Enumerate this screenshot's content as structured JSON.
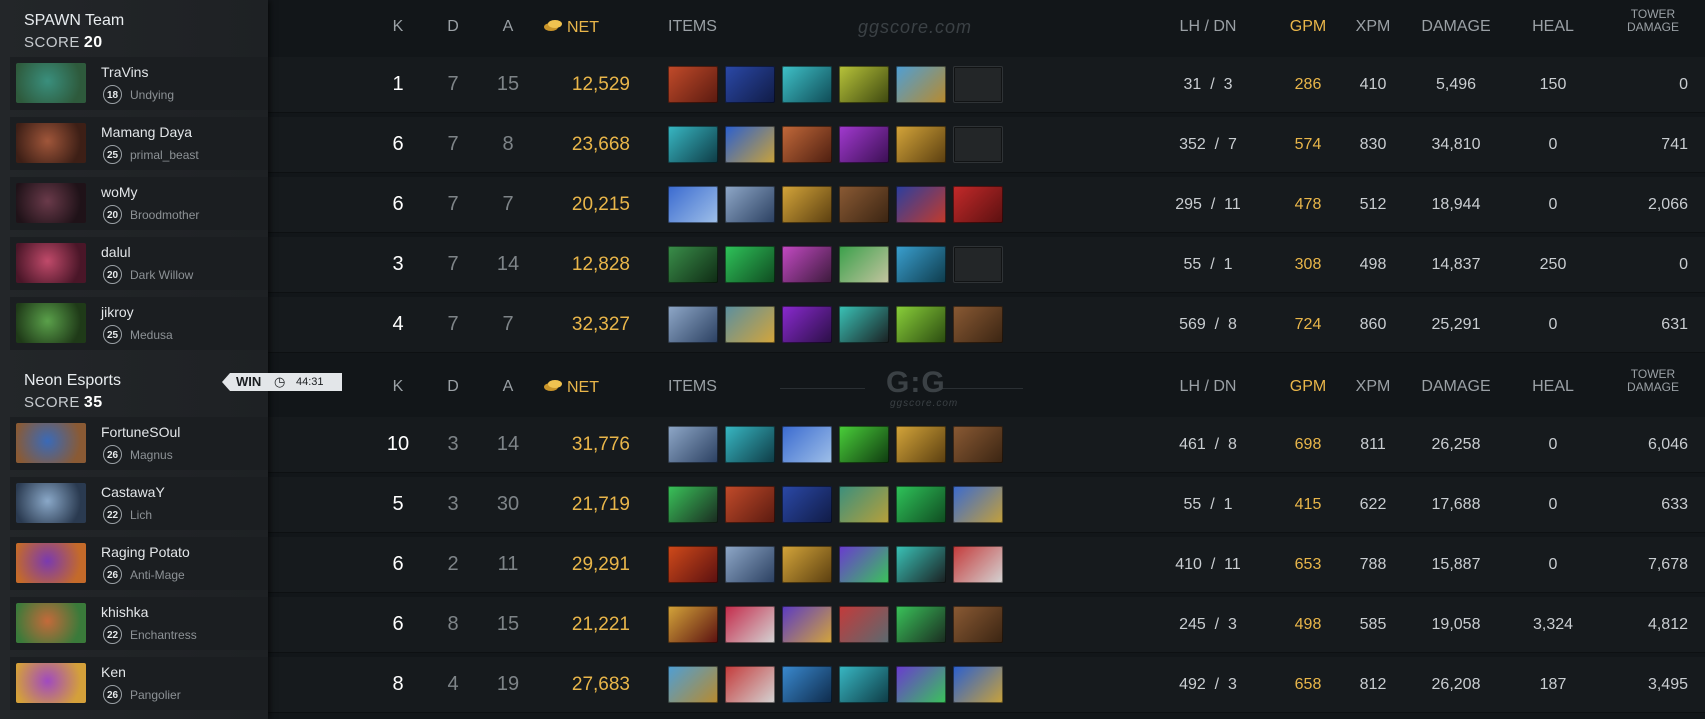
{
  "headers": {
    "k": "K",
    "d": "D",
    "a": "A",
    "net": "NET",
    "items": "ITEMS",
    "lh_dn": "LH  /  DN",
    "gpm": "GPM",
    "xpm": "XPM",
    "damage": "DAMAGE",
    "heal": "HEAL",
    "tower1": "TOWER",
    "tower2": "DAMAGE"
  },
  "watermark1": "ggscore.com",
  "watermark2_big": "G:G",
  "watermark2_small": "ggscore.com",
  "colors": {
    "gold": "#e9b64a",
    "bg": "#121619",
    "sidebar": "#232629"
  },
  "result": {
    "label": "WIN",
    "clock_icon": "clock-icon",
    "time": "44:31"
  },
  "teams": [
    {
      "name": "SPAWN Team",
      "score_label": "SCORE",
      "score": "20",
      "players": [
        {
          "name": "TraVins",
          "level": "18",
          "hero": "Undying",
          "k": "1",
          "d": "7",
          "a": "15",
          "net": "12,529",
          "lh": "31",
          "dn": "3",
          "gpm": "286",
          "xpm": "410",
          "damage": "5,496",
          "heal": "150",
          "tower": "0",
          "colors": [
            "#3a8f7d",
            "#2e5a3c"
          ],
          "items": [
            [
              "#c24b2a",
              "#5a1a10"
            ],
            [
              "#2b49a8",
              "#101b45"
            ],
            [
              "#3fc2c9",
              "#0f4a55"
            ],
            [
              "#b8c43a",
              "#3d4710"
            ],
            [
              "#4e9fd6",
              "#b98a2c"
            ],
            null
          ]
        },
        {
          "name": "Mamang Daya",
          "level": "25",
          "hero": "primal_beast",
          "k": "6",
          "d": "7",
          "a": "8",
          "net": "23,668",
          "lh": "352",
          "dn": "7",
          "gpm": "574",
          "xpm": "830",
          "damage": "34,810",
          "heal": "0",
          "tower": "741",
          "colors": [
            "#a0563a",
            "#3d1f16"
          ],
          "items": [
            [
              "#38b8c4",
              "#0e3a44"
            ],
            [
              "#2a5fd0",
              "#c9a23a"
            ],
            [
              "#c2693a",
              "#4d1e10"
            ],
            [
              "#a23ad0",
              "#3a0f52"
            ],
            [
              "#d4a53a",
              "#5a3e10"
            ],
            null
          ]
        },
        {
          "name": "woMy",
          "level": "20",
          "hero": "Broodmother",
          "k": "6",
          "d": "7",
          "a": "7",
          "net": "20,215",
          "lh": "295",
          "dn": "11",
          "gpm": "478",
          "xpm": "512",
          "damage": "18,944",
          "heal": "0",
          "tower": "2,066",
          "colors": [
            "#6a3a4a",
            "#1f1218"
          ],
          "items": [
            [
              "#3a6ad0",
              "#9fc0e8"
            ],
            [
              "#8fa8c8",
              "#2a3f60"
            ],
            [
              "#d4a53a",
              "#5a3e10"
            ],
            [
              "#8a5a34",
              "#3a2412"
            ],
            [
              "#2a3fa0",
              "#c43a2a"
            ],
            [
              "#c42a2a",
              "#5a1010"
            ]
          ]
        },
        {
          "name": "dalul",
          "level": "20",
          "hero": "Dark Willow",
          "k": "3",
          "d": "7",
          "a": "14",
          "net": "12,828",
          "lh": "55",
          "dn": "1",
          "gpm": "308",
          "xpm": "498",
          "damage": "14,837",
          "heal": "250",
          "tower": "0",
          "colors": [
            "#c04a6a",
            "#4a1628"
          ],
          "items": [
            [
              "#3a8f4a",
              "#0f2a14"
            ],
            [
              "#2fc45a",
              "#0f4a20"
            ],
            [
              "#c44ac4",
              "#3a1a3a"
            ],
            [
              "#3aa04a",
              "#c4c4a0"
            ],
            [
              "#3aa0d0",
              "#0e3a4a"
            ],
            null
          ]
        },
        {
          "name": "jikroy",
          "level": "25",
          "hero": "Medusa",
          "k": "4",
          "d": "7",
          "a": "7",
          "net": "32,327",
          "lh": "569",
          "dn": "8",
          "gpm": "724",
          "xpm": "860",
          "damage": "25,291",
          "heal": "0",
          "tower": "631",
          "colors": [
            "#5aa04a",
            "#1f3a18"
          ],
          "items": [
            [
              "#8fa8c8",
              "#2a3f60"
            ],
            [
              "#5a8fa0",
              "#d4a53a"
            ],
            [
              "#8a2ad0",
              "#2a0f45"
            ],
            [
              "#3ac4b8",
              "#1a1e20"
            ],
            [
              "#8ad03a",
              "#2a4a10"
            ],
            [
              "#8a5a34",
              "#3a2412"
            ]
          ]
        }
      ]
    },
    {
      "name": "Neon Esports",
      "score_label": "SCORE",
      "score": "35",
      "players": [
        {
          "name": "FortuneSOul",
          "level": "26",
          "hero": "Magnus",
          "k": "10",
          "d": "3",
          "a": "14",
          "net": "31,776",
          "lh": "461",
          "dn": "8",
          "gpm": "698",
          "xpm": "811",
          "damage": "26,258",
          "heal": "0",
          "tower": "6,046",
          "colors": [
            "#3a6ab8",
            "#8a5a34"
          ],
          "items": [
            [
              "#8fa8c8",
              "#2a3f60"
            ],
            [
              "#38b8c4",
              "#0e3a44"
            ],
            [
              "#3a6ad0",
              "#9fc0e8"
            ],
            [
              "#4ad03a",
              "#0f3a10"
            ],
            [
              "#d4a53a",
              "#5a3e10"
            ],
            [
              "#8a5a34",
              "#3a2412"
            ]
          ]
        },
        {
          "name": "CastawaY",
          "level": "22",
          "hero": "Lich",
          "k": "5",
          "d": "3",
          "a": "30",
          "net": "21,719",
          "lh": "55",
          "dn": "1",
          "gpm": "415",
          "xpm": "622",
          "damage": "17,688",
          "heal": "0",
          "tower": "633",
          "colors": [
            "#8aa8c8",
            "#2a3a50"
          ],
          "items": [
            [
              "#3ac45a",
              "#1a2a20"
            ],
            [
              "#c24b2a",
              "#5a1a10"
            ],
            [
              "#2b49a8",
              "#101b45"
            ],
            [
              "#3a8f7d",
              "#b8a03a"
            ],
            [
              "#2fc45a",
              "#0f4a20"
            ],
            [
              "#3a6ad0",
              "#c4a03a"
            ]
          ]
        },
        {
          "name": "Raging Potato",
          "level": "26",
          "hero": "Anti-Mage",
          "k": "6",
          "d": "2",
          "a": "11",
          "net": "29,291",
          "lh": "410",
          "dn": "11",
          "gpm": "653",
          "xpm": "788",
          "damage": "15,887",
          "heal": "0",
          "tower": "7,678",
          "colors": [
            "#7a3ab0",
            "#c46a2a"
          ],
          "items": [
            [
              "#d04a1a",
              "#5a1010"
            ],
            [
              "#8fa8c8",
              "#2a3f60"
            ],
            [
              "#d4a53a",
              "#5a3e10"
            ],
            [
              "#6a3ad0",
              "#3ac45a"
            ],
            [
              "#3ac4b8",
              "#1a1e20"
            ],
            [
              "#c43a3a",
              "#d4d4d4"
            ]
          ]
        },
        {
          "name": "khishka",
          "level": "22",
          "hero": "Enchantress",
          "k": "6",
          "d": "8",
          "a": "15",
          "net": "21,221",
          "lh": "245",
          "dn": "3",
          "gpm": "498",
          "xpm": "585",
          "damage": "19,058",
          "heal": "3,324",
          "tower": "4,812",
          "colors": [
            "#c46a3a",
            "#3a7a3a"
          ],
          "items": [
            [
              "#d4a53a",
              "#5a1010"
            ],
            [
              "#c42a4a",
              "#d4d4d4"
            ],
            [
              "#5a3ac4",
              "#d4a53a"
            ],
            [
              "#c43a3a",
              "#5a6a70"
            ],
            [
              "#3ac45a",
              "#1a2a20"
            ],
            [
              "#8a5a34",
              "#3a2412"
            ]
          ]
        },
        {
          "name": "Ken",
          "level": "26",
          "hero": "Pangolier",
          "k": "8",
          "d": "4",
          "a": "19",
          "net": "27,683",
          "lh": "492",
          "dn": "3",
          "gpm": "658",
          "xpm": "812",
          "damage": "26,208",
          "heal": "187",
          "tower": "3,495",
          "colors": [
            "#a04ac0",
            "#d4a03a"
          ],
          "items": [
            [
              "#4e9fd6",
              "#b98a2c"
            ],
            [
              "#c43a3a",
              "#d4d4d4"
            ],
            [
              "#3a8ad0",
              "#0e2a4a"
            ],
            [
              "#38b8c4",
              "#0e3a44"
            ],
            [
              "#6a3ad0",
              "#3ac45a"
            ],
            [
              "#2a5fd0",
              "#c9a23a"
            ]
          ]
        }
      ]
    }
  ]
}
